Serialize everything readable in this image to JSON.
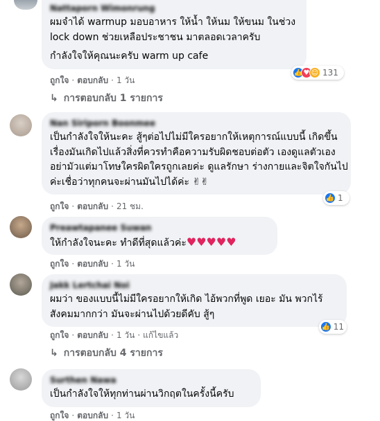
{
  "comments": [
    {
      "author": "Nattaporn Wimonrung",
      "text": "ผมจำได้ warmup มอบอาหาร ให้น้ำ ให้นม ให้ขนม ในช่วง lock down ช่วยเหลือประชาชน มาตลอดเวลาครับ",
      "text2": "กำลังใจให้คุณนะครับ warm up cafe",
      "like": "ถูกใจ",
      "reply": "ตอบกลับ",
      "time": "1 วัน",
      "reaction_count": "131",
      "reaction_icons": [
        "like-icon",
        "love-icon",
        "care-icon"
      ],
      "replies_label": "การตอบกลับ 1 รายการ"
    },
    {
      "author": "Nan Siriporn Boonmee",
      "text": "เป็นกำลังใจให้นะคะ สู้ๆต่อไปไม่มีใครอยากให้เหตุการณ์แบบนี้ เกิดขึ้นเรื่องมันเกิดไปแล้วสิ่งที่ควรทำคือความรับผิดชอบต่อตัว เองดูแลตัวเองอย่ามัวแต่มาโทษใครผิดใครถูกเลยค่ะ ดูแลรักษา ร่างกายและจิตใจกันไปค่ะเชื่อว่าทุกคนจะผ่านมันไปได้ค่ะ ✌✌",
      "like": "ถูกใจ",
      "reply": "ตอบกลับ",
      "time": "21 ชม.",
      "reaction_count": "1",
      "reaction_icons": [
        "like-icon"
      ]
    },
    {
      "author": "Preawtapanee Suwan",
      "text": "ให้กำลังใจนะคะ ทำดีที่สุดแล้วค่ะ♥♥♥♥♥",
      "like": "ถูกใจ",
      "reply": "ตอบกลับ",
      "time": "1 วัน"
    },
    {
      "author": "Jakk Lertchai Noi",
      "text": "ผมว่า ของแบบนี้ไม่มีใครอยากให้เกิด ไอ้พวกที่พูด เยอะ มัน พวกไร้สังคมมากกว่า มันจะผ่านไปด้วยดีคับ สู้ๆ",
      "like": "ถูกใจ",
      "reply": "ตอบกลับ",
      "time": "1 วัน",
      "edited": "แก้ไขแล้ว",
      "reaction_count": "11",
      "reaction_icons": [
        "like-icon"
      ],
      "replies_label": "การตอบกลับ 4 รายการ"
    },
    {
      "author": "Surthen Nawa",
      "text": "เป็นกำลังใจให้ทุกท่านผ่านวิกฤตในครั้งนี้ครับ",
      "like": "ถูกใจ",
      "reply": "ตอบกลับ",
      "time": "1 วัน"
    }
  ],
  "colors": {
    "bubble": "#f0f2f5",
    "meta": "#65676b",
    "like_blue": "#1877f2",
    "love_red": "#f33e58",
    "care_yellow": "#f7b125",
    "heart": "#e0245e"
  }
}
